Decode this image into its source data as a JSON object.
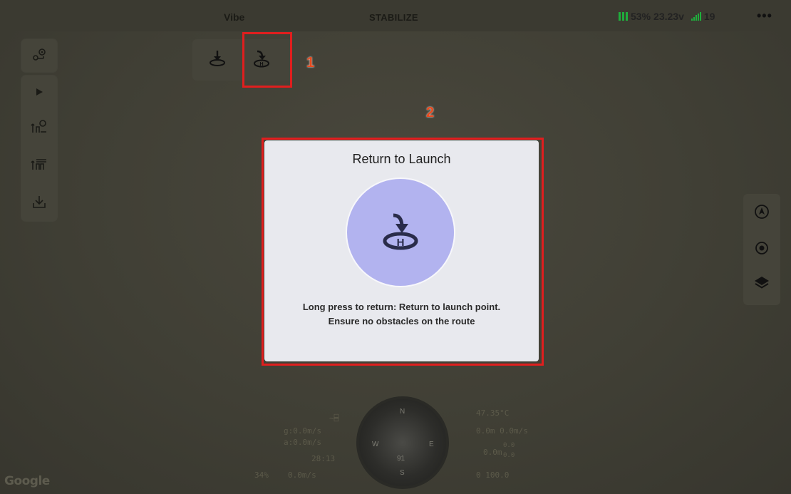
{
  "topbar": {
    "vehicle_name": "Vibe",
    "flight_mode": "STABILIZE",
    "battery_percent": "53%",
    "battery_voltage": "23.23v",
    "satellites": "19",
    "more_label": "•••"
  },
  "sidebar": {
    "items": [
      {
        "icon": "map-route-icon"
      },
      {
        "icon": "play-icon"
      },
      {
        "icon": "waypoint-settings-icon"
      },
      {
        "icon": "mission-list-icon"
      },
      {
        "icon": "download-icon"
      }
    ]
  },
  "top_actions": {
    "items": [
      {
        "icon": "land-icon"
      },
      {
        "icon": "return-to-launch-icon"
      }
    ]
  },
  "annotations": {
    "marker_1": "1",
    "marker_2": "2"
  },
  "dialog": {
    "title": "Return to Launch",
    "description_line1": "Long press to return: Return to launch point.",
    "description_line2": "Ensure no obstacles on the route",
    "button_icon": "return-to-launch-icon",
    "circle_color": "#b2b3ef"
  },
  "right_controls": {
    "items": [
      {
        "icon": "navigate-icon"
      },
      {
        "icon": "locate-icon"
      },
      {
        "icon": "layers-icon"
      }
    ]
  },
  "hud": {
    "temperature": "47.35°C",
    "alt_speed": "0.0m 0.0m/s",
    "ground_speed": "g:0.0m/s",
    "air_speed": "a:0.0m/s",
    "distance": "0.0m",
    "distance_sub1": "0.0",
    "distance_sub2": "0.0",
    "time": "28:13",
    "throttle": "34%",
    "vert_speed": "0.0m/s",
    "wind": "0 100.0",
    "compass_heading": "91",
    "compass_n": "N",
    "compass_s": "S",
    "compass_e": "E",
    "compass_w": "W"
  },
  "map": {
    "attribution": "Google"
  },
  "colors": {
    "highlight": "#e01e1e",
    "battery_green": "#1fae3c",
    "marker": "#e84a1e"
  }
}
